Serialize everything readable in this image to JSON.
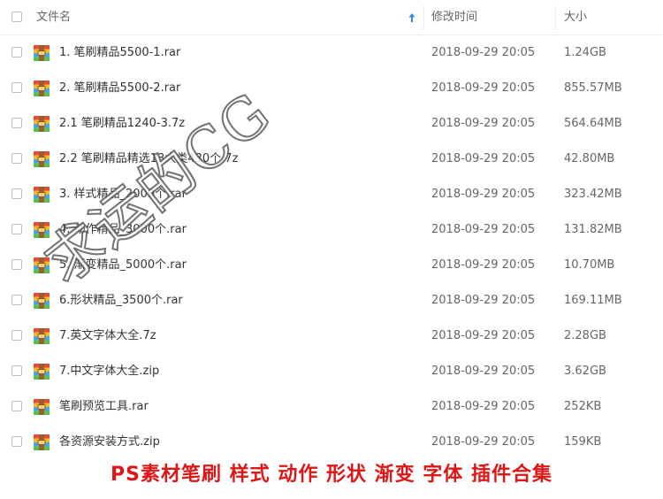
{
  "header": {
    "name_label": "文件名",
    "date_label": "修改时间",
    "size_label": "大小",
    "sort_icon": "arrow-up-icon"
  },
  "colors": {
    "accent": "#2b8ae6",
    "banner_red": "#e01616",
    "text": "#333333",
    "muted": "#666666"
  },
  "files": [
    {
      "name": "1. 笔刷精品5500-1.rar",
      "date": "2018-09-29 20:05",
      "size": "1.24GB"
    },
    {
      "name": "2. 笔刷精品5500-2.rar",
      "date": "2018-09-29 20:05",
      "size": "855.57MB"
    },
    {
      "name": "2.1 笔刷精品1240-3.7z",
      "date": "2018-09-29 20:05",
      "size": "564.64MB"
    },
    {
      "name": "2.2 笔刷精品精选13大类430个.7z",
      "date": "2018-09-29 20:05",
      "size": "42.80MB"
    },
    {
      "name": "3. 样式精品_2000个.rar",
      "date": "2018-09-29 20:05",
      "size": "323.42MB"
    },
    {
      "name": "4. 动作精品_3000个.rar",
      "date": "2018-09-29 20:05",
      "size": "131.82MB"
    },
    {
      "name": "5. 渐变精品_5000个.rar",
      "date": "2018-09-29 20:05",
      "size": "10.70MB"
    },
    {
      "name": "6.形状精品_3500个.rar",
      "date": "2018-09-29 20:05",
      "size": "169.11MB"
    },
    {
      "name": "7.英文字体大全.7z",
      "date": "2018-09-29 20:05",
      "size": "2.28GB"
    },
    {
      "name": "7.中文字体大全.zip",
      "date": "2018-09-29 20:05",
      "size": "3.62GB"
    },
    {
      "name": "笔刷预览工具.rar",
      "date": "2018-09-29 20:05",
      "size": "252KB"
    },
    {
      "name": "各资源安装方式.zip",
      "date": "2018-09-29 20:05",
      "size": "159KB"
    }
  ],
  "file_icon": "archive-file-icon",
  "watermark": "求运的CG",
  "banner": "PS素材笔刷 样式 动作 形状 渐变 字体 插件合集"
}
